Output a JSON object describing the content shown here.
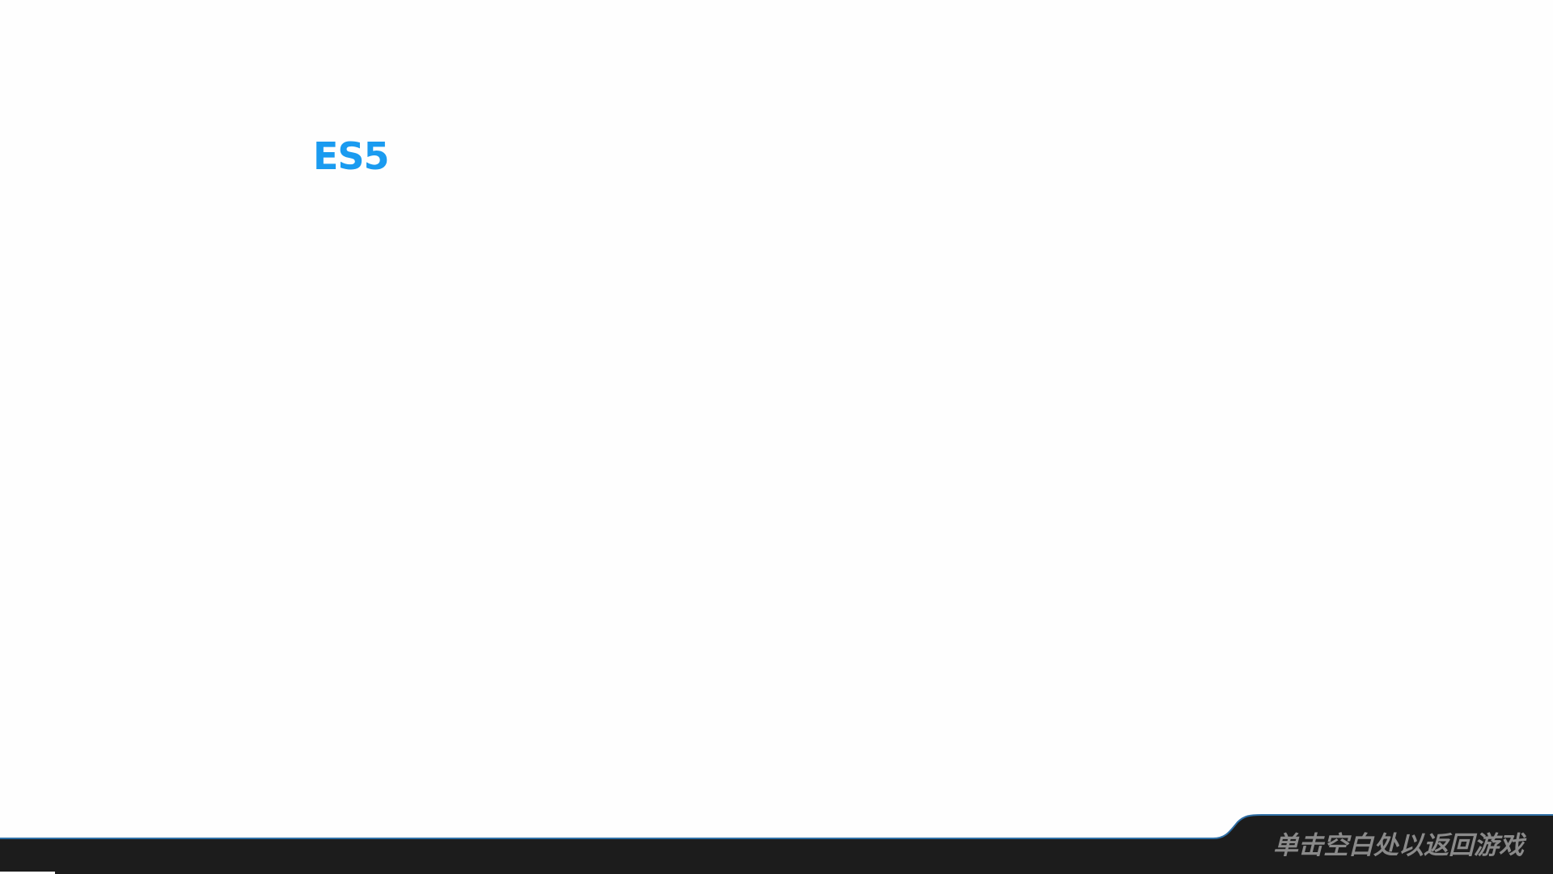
{
  "document": {
    "title": "ES5"
  },
  "overlay": {
    "return_hint": "单击空白处以返回游戏"
  },
  "colors": {
    "title_accent": "#1a9bf0",
    "page_background": "#fefefe",
    "bar_background": "#1c1c1c",
    "bar_edge": "#2f6fa5",
    "hint_text": "#8a8a8a"
  }
}
